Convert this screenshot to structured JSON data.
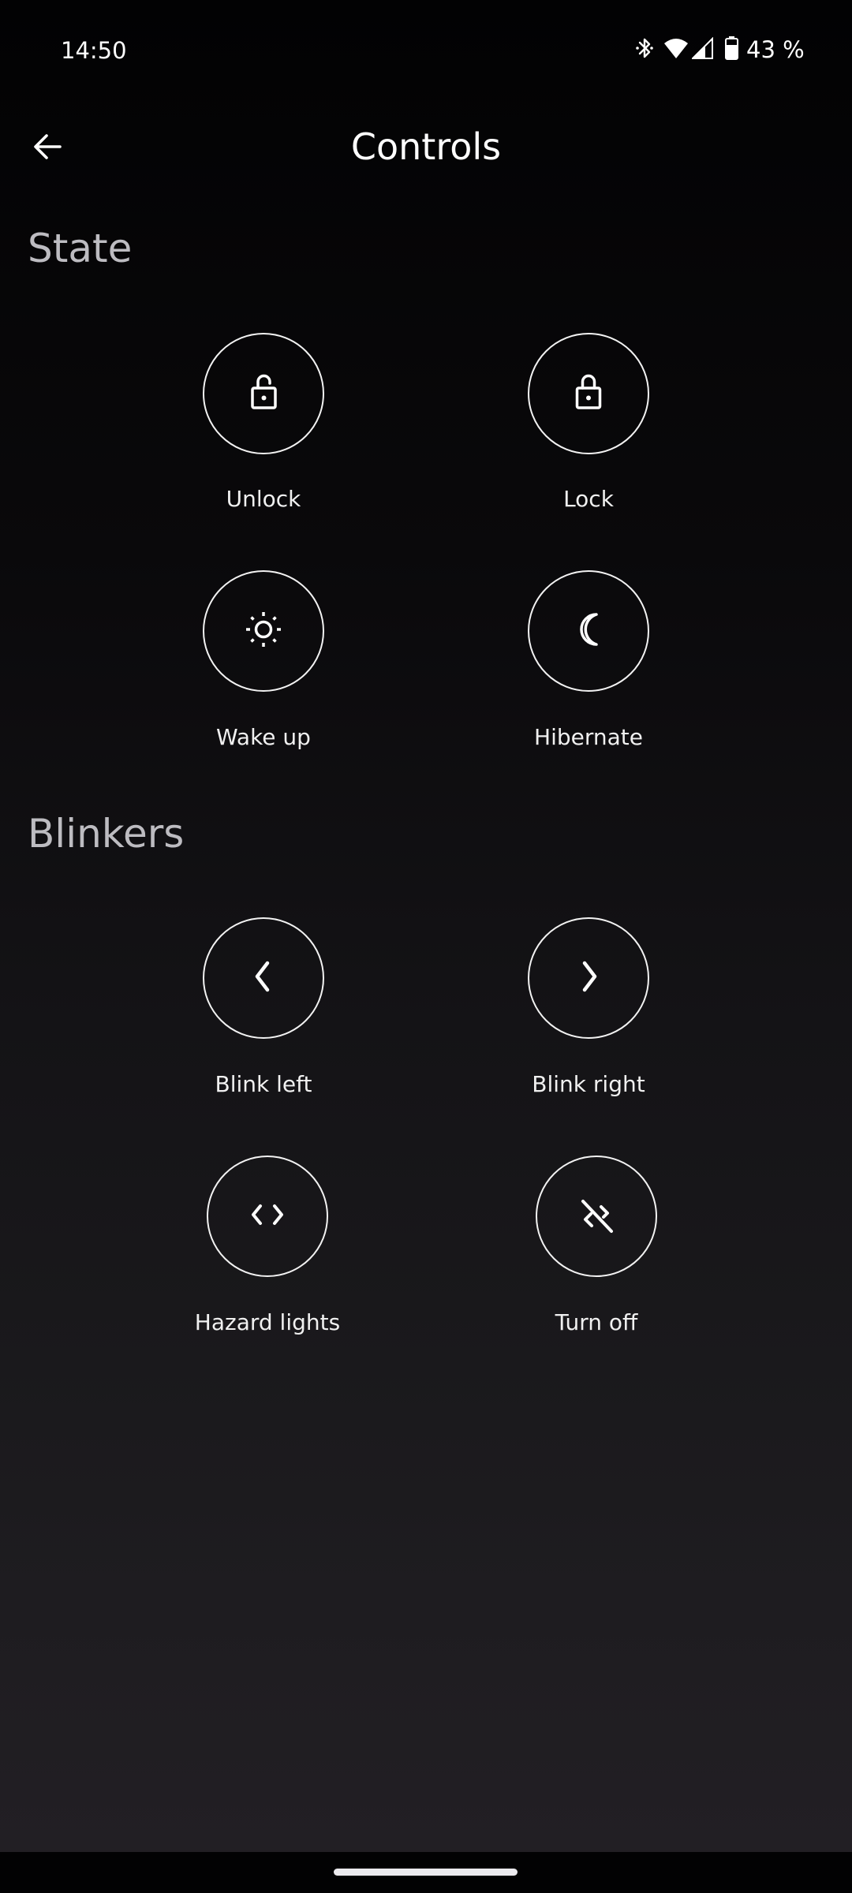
{
  "status_bar": {
    "time": "14:50",
    "icons": [
      "bluetooth-icon",
      "wifi-icon",
      "cell-signal-icon",
      "battery-icon"
    ],
    "battery_percent": "43 %"
  },
  "header": {
    "back_icon": "arrow-left-icon",
    "title": "Controls"
  },
  "sections": [
    {
      "title": "State",
      "controls": [
        {
          "label": "Unlock",
          "icon": "unlock-icon"
        },
        {
          "label": "Lock",
          "icon": "lock-icon"
        },
        {
          "label": "Wake up",
          "icon": "sun-icon"
        },
        {
          "label": "Hibernate",
          "icon": "moon-icon"
        }
      ]
    },
    {
      "title": "Blinkers",
      "controls": [
        {
          "label": "Blink left",
          "icon": "chevron-left-icon"
        },
        {
          "label": "Blink right",
          "icon": "chevron-right-icon"
        },
        {
          "label": "Hazard lights",
          "icon": "hazard-chevrons-icon"
        },
        {
          "label": "Turn off",
          "icon": "blinkers-off-icon"
        }
      ]
    }
  ],
  "colors": {
    "background_top": "#020203",
    "background_bottom": "#221f24",
    "section_title": "#bdbcc1",
    "foreground": "#ffffff"
  }
}
